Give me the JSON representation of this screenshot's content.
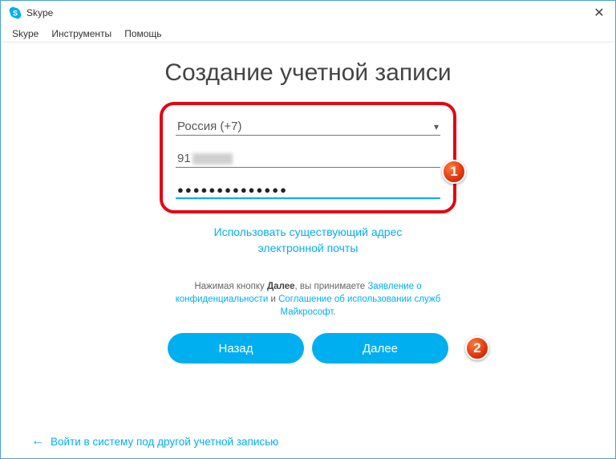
{
  "window": {
    "title": "Skype",
    "close": "✕"
  },
  "menu": {
    "items": [
      "Skype",
      "Инструменты",
      "Помощь"
    ]
  },
  "heading": "Создание учетной записи",
  "form": {
    "country": "Россия (+7)",
    "phone_prefix": "91",
    "password_masked": "●●●●●●●●●●●●●●"
  },
  "links": {
    "use_email": "Использовать существующий адрес электронной почты"
  },
  "agreement": {
    "prefix": "Нажимая кнопку ",
    "bold": "Далее",
    "mid": ", вы принимаете ",
    "privacy": "Заявление о конфиденциальности",
    "and": " и ",
    "terms": "Соглашение об использовании служб Майкрософт",
    "suffix": "."
  },
  "buttons": {
    "back": "Назад",
    "next": "Далее"
  },
  "footer": {
    "other_account": "Войти в систему под другой учетной записью"
  },
  "annotations": {
    "badge1": "1",
    "badge2": "2"
  },
  "colors": {
    "accent": "#00aff0",
    "annotation": "#e30613"
  }
}
